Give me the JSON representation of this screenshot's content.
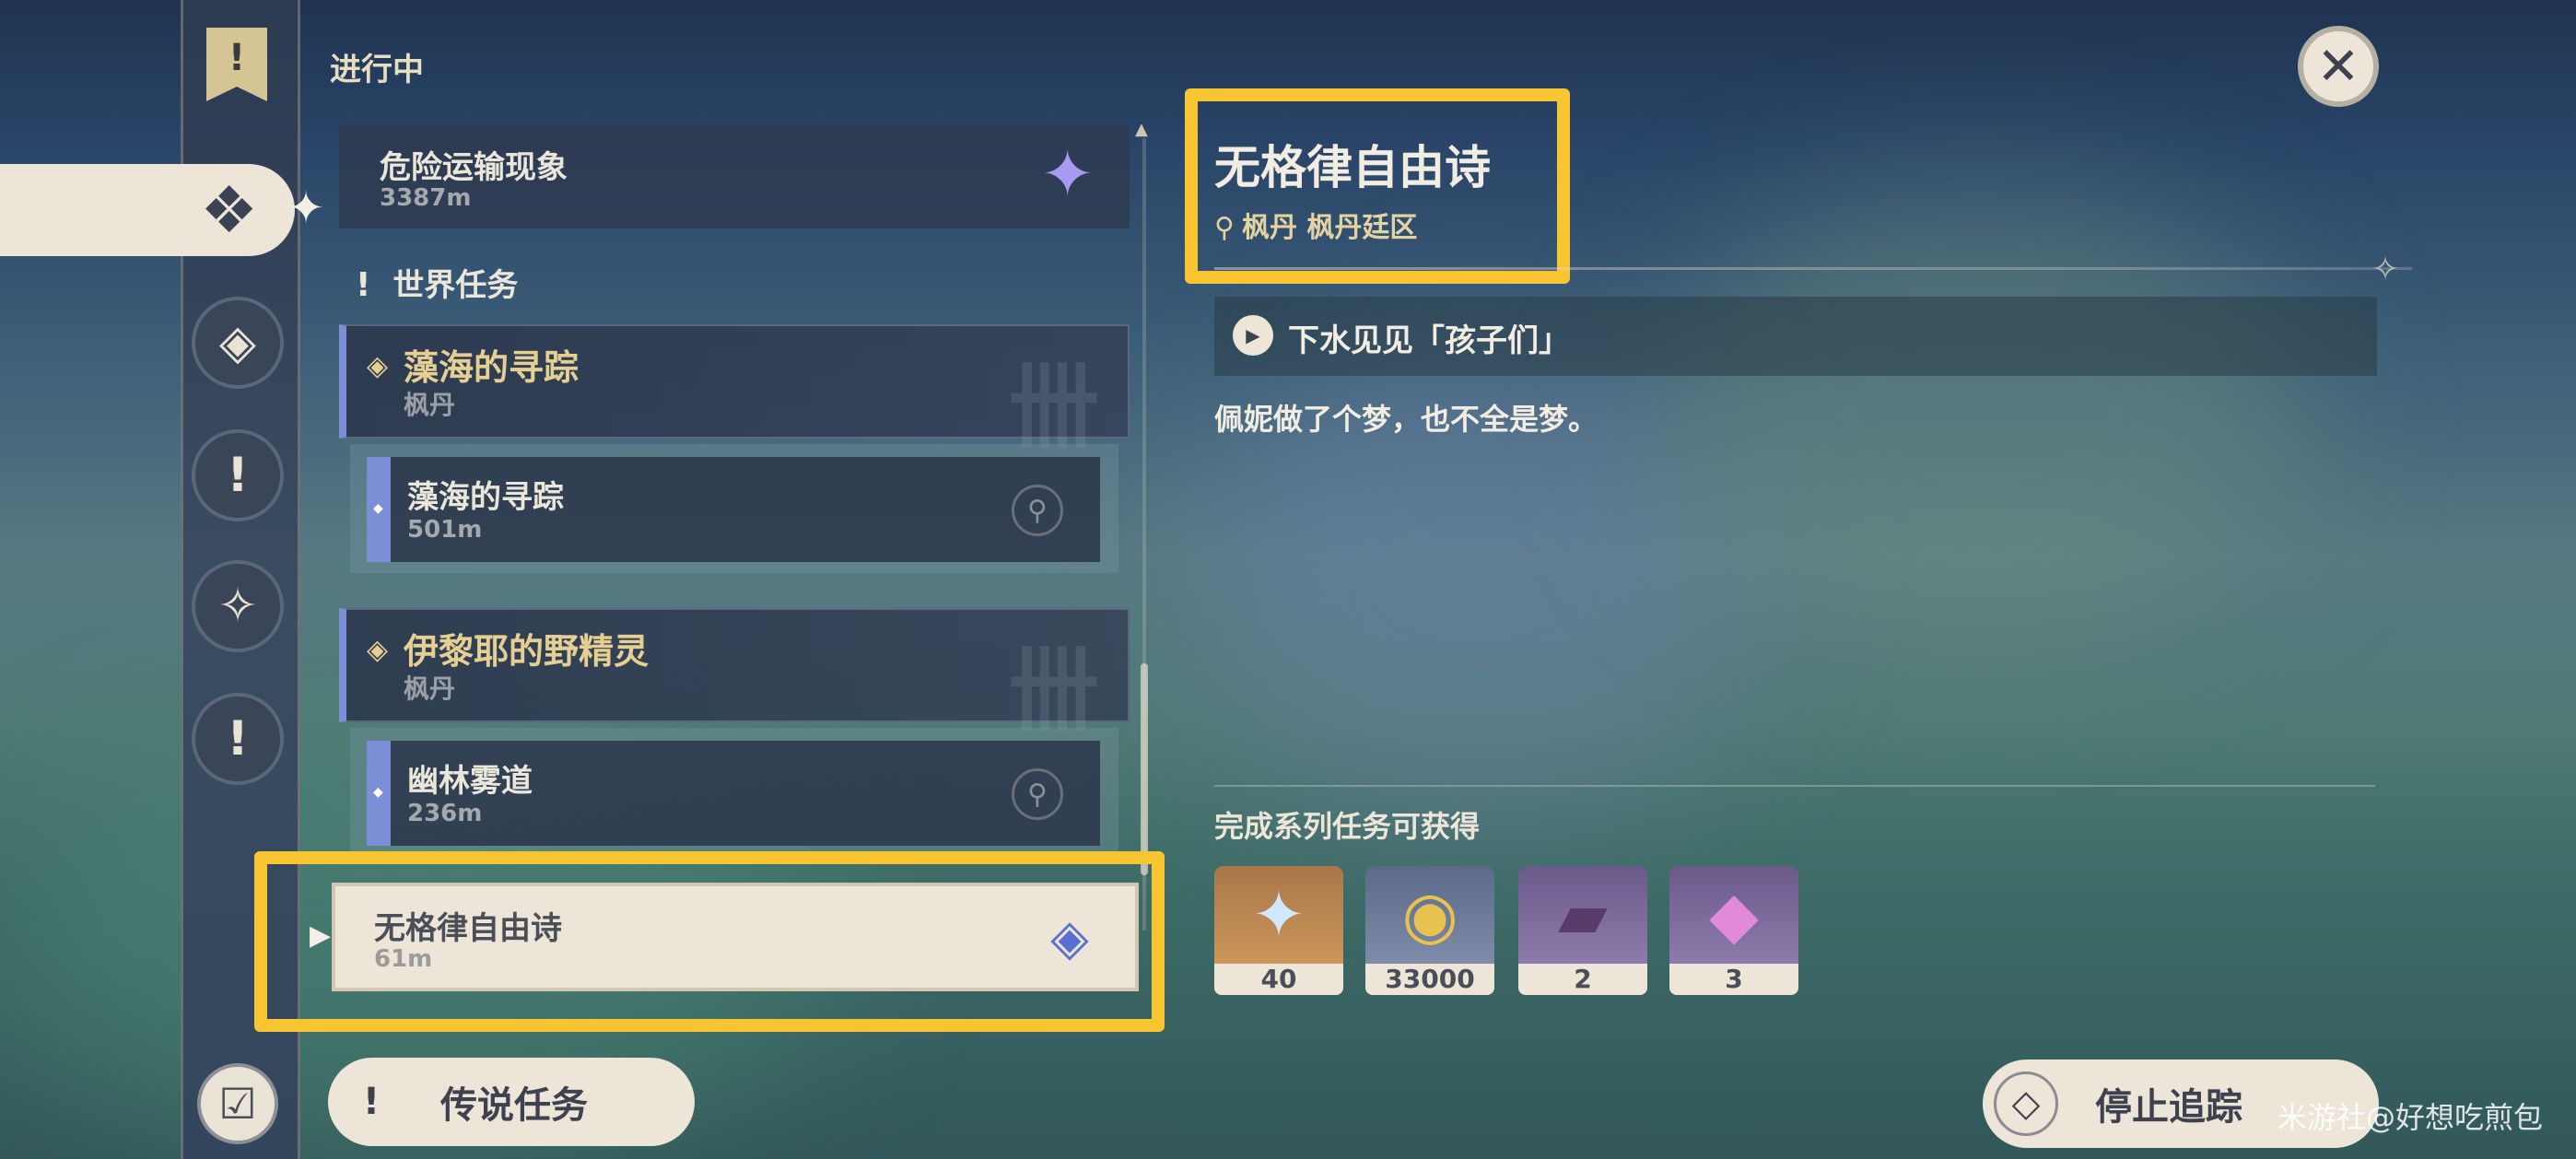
{
  "colors": {
    "highlight": "#f7c531",
    "accent_blue": "#7b8fd6",
    "gold_text": "#e6cf92",
    "cream": "#ece5d8"
  },
  "list": {
    "section_heading": "进行中",
    "top_quest": {
      "title": "危险运输现象",
      "distance": "3387m",
      "icon": "purple-star-quest-icon"
    },
    "world_heading": "世界任务",
    "groups": [
      {
        "title": "藻海的寻踪",
        "region": "枫丹",
        "sub": {
          "title": "藻海的寻踪",
          "distance": "501m"
        }
      },
      {
        "title": "伊黎耶的野精灵",
        "region": "枫丹",
        "sub": {
          "title": "幽林雾道",
          "distance": "236m"
        }
      }
    ],
    "selected": {
      "title": "无格律自由诗",
      "distance": "61m"
    }
  },
  "buttons": {
    "legend_quests": "传说任务",
    "stop_tracking": "停止追踪"
  },
  "detail": {
    "title": "无格律自由诗",
    "location": "枫丹  枫丹廷区",
    "step": "下水见见「孩子们」",
    "description": "佩妮做了个梦，也不全是梦。",
    "rewards_label": "完成系列任务可获得",
    "rewards": [
      {
        "icon": "primogem-icon",
        "count": "40"
      },
      {
        "icon": "mora-icon",
        "count": "33000"
      },
      {
        "icon": "heros-wit-book-icon",
        "count": "2"
      },
      {
        "icon": "mystic-enhancement-ore-icon",
        "count": "3"
      }
    ]
  },
  "watermark": "米游社@好想吃煎包"
}
